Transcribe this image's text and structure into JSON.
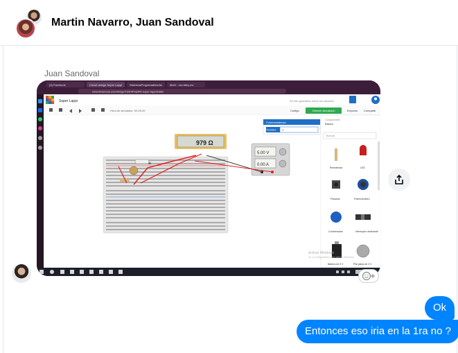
{
  "header": {
    "title": "Martin Navarro, Juan Sandoval"
  },
  "thread": {
    "sender_name": "Juan Sandoval",
    "messages": [
      {
        "text": "Ok"
      },
      {
        "text": "Entonces eso iria en la 1ra no ?"
      }
    ]
  },
  "screenshot": {
    "browser_tabs": [
      "(3) Facebook",
      "Circuit design Super Lappi",
      "SistemasProgramables/Ac",
      "Meet - vsc-bbtq-rov"
    ],
    "url": "www.tinkercad.com/things/TjntHiPxfyRR-super-lappi/editel",
    "project_name": "Super Lappi",
    "save_status": "Se han guardado todos los cambios",
    "sim_time": "Hora de simulador: 00:00:20",
    "code_label": "Código",
    "stop_sim_label": "Detener simulación",
    "export_label": "Exportar",
    "share_label": "Compartir",
    "panel_title": "Fotorresistencia",
    "name_label": "Nombre",
    "name_value": "1",
    "components_label": "Componentes",
    "components_value": "Básico",
    "search_placeholder": "Buscar",
    "multimeter_reading": "979 Ω",
    "psu_voltage": "5.00 V",
    "psu_current": "0.00 A",
    "components": [
      {
        "label": "Resistencia"
      },
      {
        "label": "LED"
      },
      {
        "label": "Pulsador"
      },
      {
        "label": "Potenciómetro"
      },
      {
        "label": "Condensador"
      },
      {
        "label": "Interruptor deslizante"
      },
      {
        "label": "Batería de 9 V"
      },
      {
        "label": "Pila plana de 3 V"
      }
    ],
    "activate_line1": "Activar Windows",
    "activate_line2": "Ve a Configuración para activar Windows.",
    "colors": {
      "browser_bar": "#3c1e3a",
      "stop_button": "#2eaa4f",
      "panel_header": "#1f6fc6",
      "multimeter_frame": "#e8c060",
      "wire_red": "#e21f1f"
    }
  },
  "colors": {
    "accent": "#0084ff",
    "header_text": "#050505",
    "muted_text": "#65676b"
  }
}
